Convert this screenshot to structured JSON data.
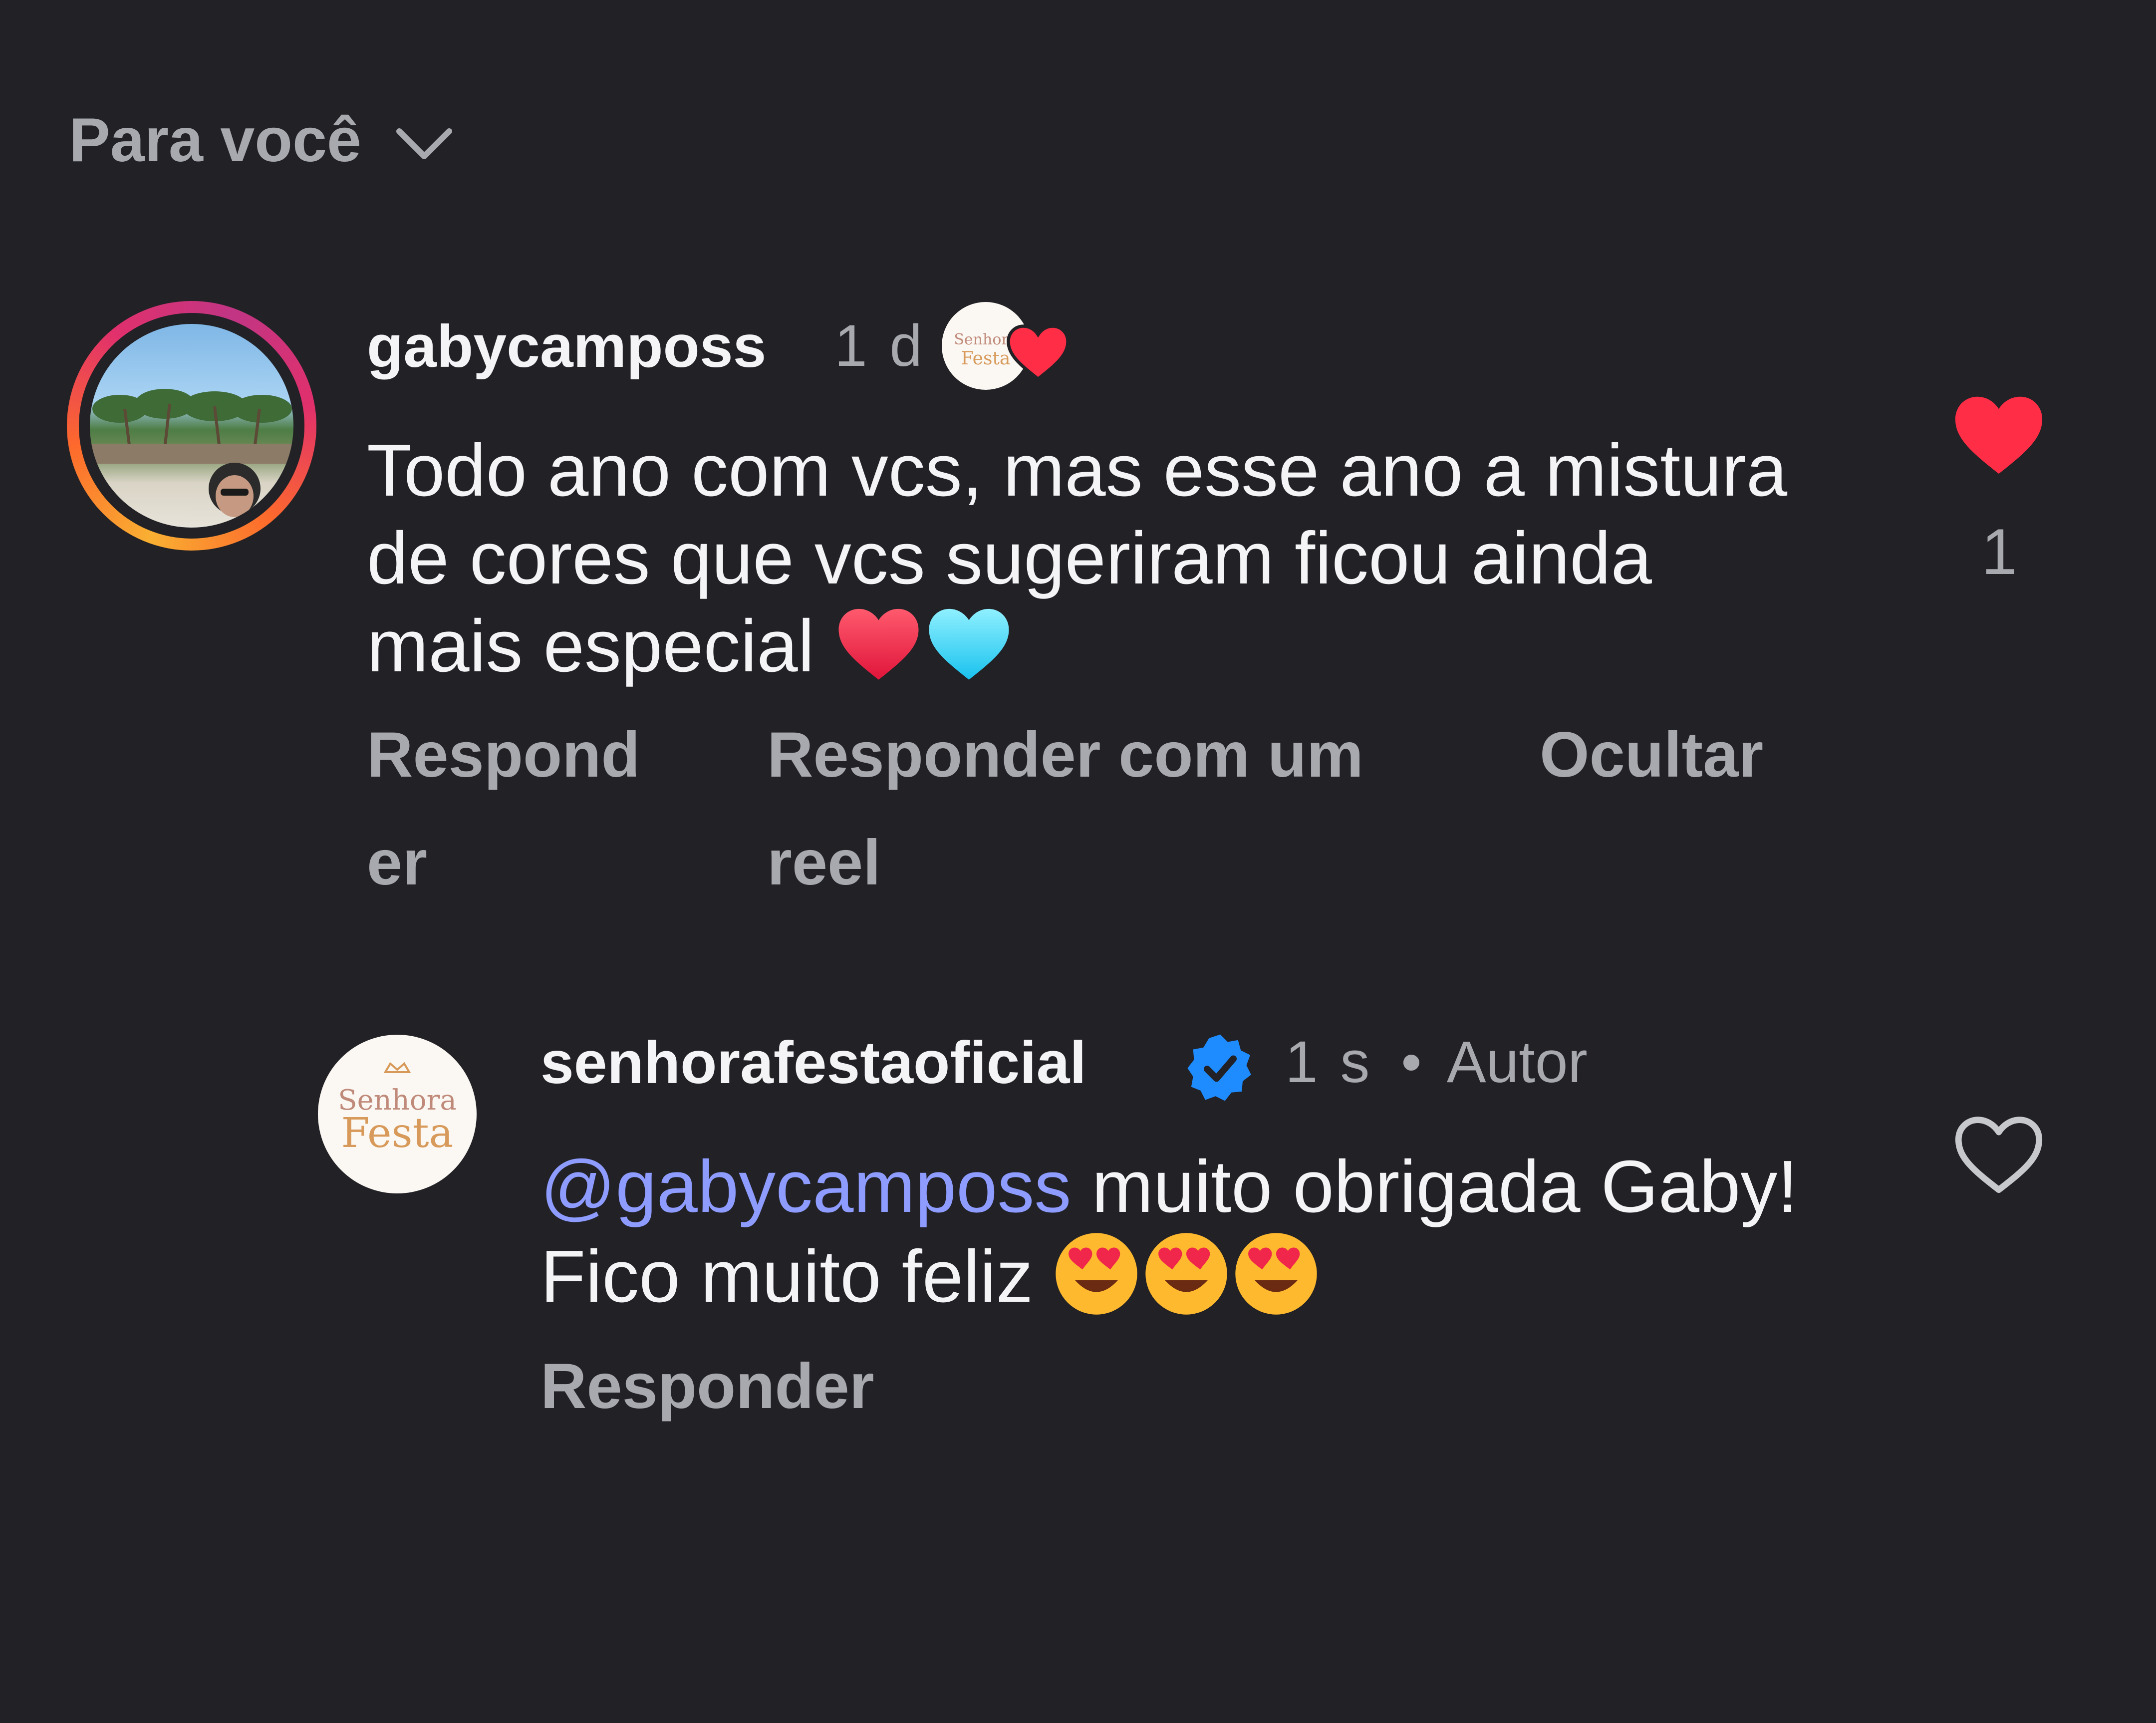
{
  "header": {
    "sort_label": "Para você"
  },
  "comments": [
    {
      "username": "gabycamposs",
      "time": "1 d",
      "text": "Todo ano com vcs, mas esse ano a mistura de cores que vcs sugeriram ficou ainda mais especial",
      "emojis": [
        "red-heart",
        "light-blue-heart"
      ],
      "like_count": "1",
      "liked": true,
      "actions": {
        "reply": "Responder",
        "reply_reel": "Responder com um reel",
        "hide": "Ocultar"
      }
    },
    {
      "username": "senhorafestaoficial",
      "verified": true,
      "time": "1 s",
      "separator": "•",
      "author_label": "Autor",
      "mention": "@gabycamposs",
      "text": " muito obrigada Gaby! Fico muito feliz",
      "emojis": [
        "heart-eyes",
        "heart-eyes",
        "heart-eyes"
      ],
      "liked": false,
      "actions": {
        "reply": "Responder"
      }
    }
  ],
  "logo": {
    "line1": "Senhora",
    "line2": "Festa"
  },
  "colors": {
    "background": "#212126",
    "primary_text": "#f4f4f6",
    "secondary_text": "#a8a9ae",
    "mention": "#8e9cff",
    "like_red": "#ff2d46",
    "verified_blue": "#1e8bff"
  }
}
